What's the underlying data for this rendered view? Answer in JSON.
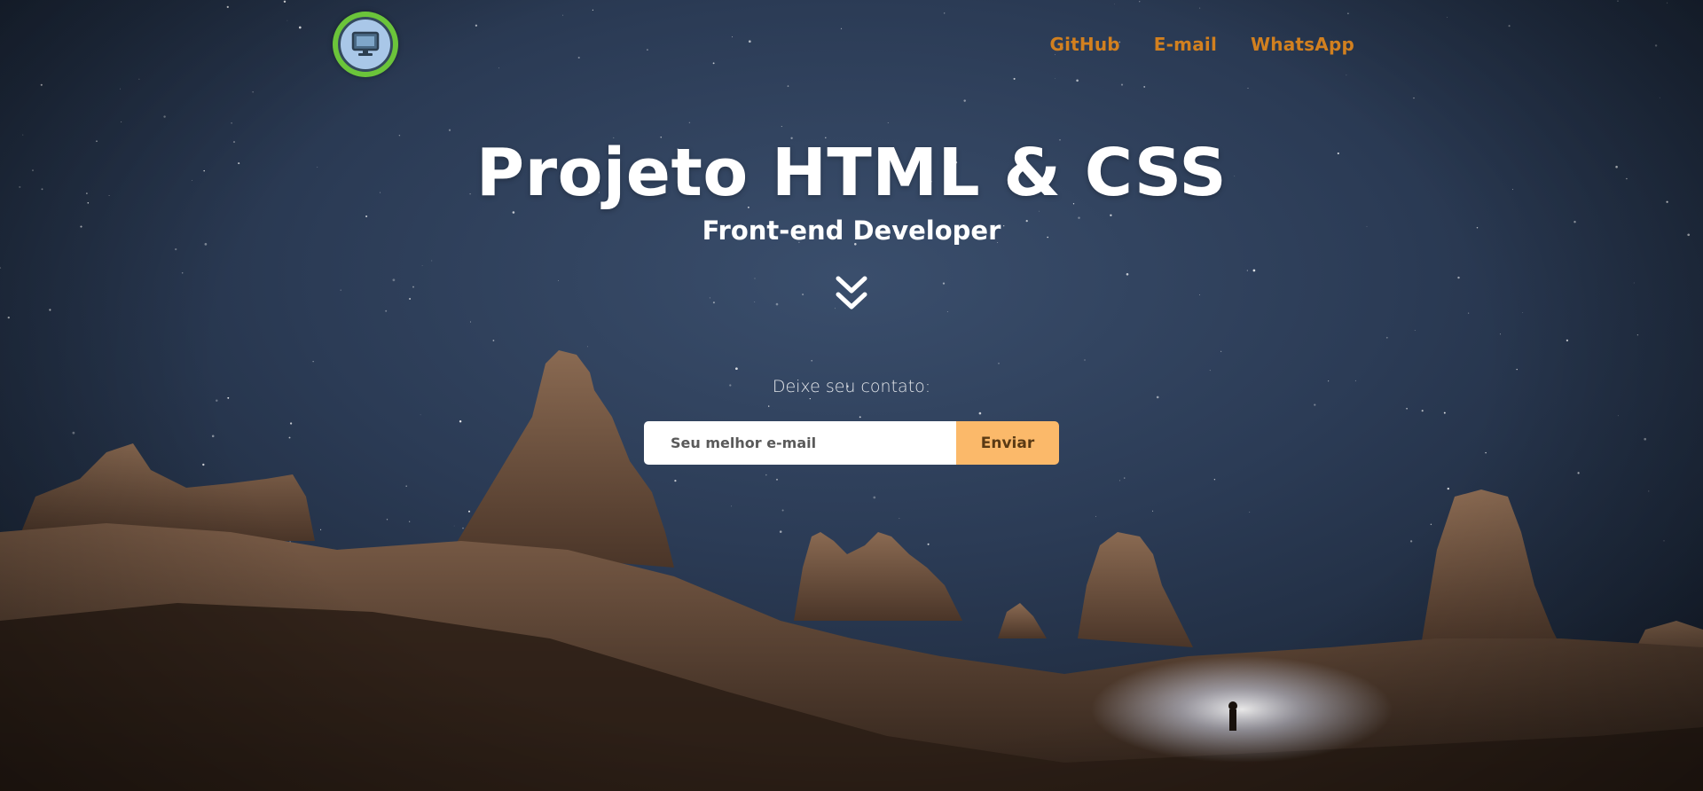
{
  "header": {
    "logo_icon": "monitor-icon",
    "nav": [
      {
        "label": "GitHub"
      },
      {
        "label": "E-mail"
      },
      {
        "label": "WhatsApp"
      }
    ]
  },
  "hero": {
    "title": "Projeto HTML & CSS",
    "subtitle": "Front-end Developer",
    "scroll_icon": "double-chevron-down-icon"
  },
  "contact": {
    "label": "Deixe seu contato:",
    "email_placeholder": "Seu melhor e-mail",
    "email_value": "",
    "submit_label": "Enviar"
  },
  "colors": {
    "nav_link": "#d2801f",
    "logo_ring": "#6bc43a",
    "button": "#fbb96a",
    "sky": "#2b3b55"
  }
}
